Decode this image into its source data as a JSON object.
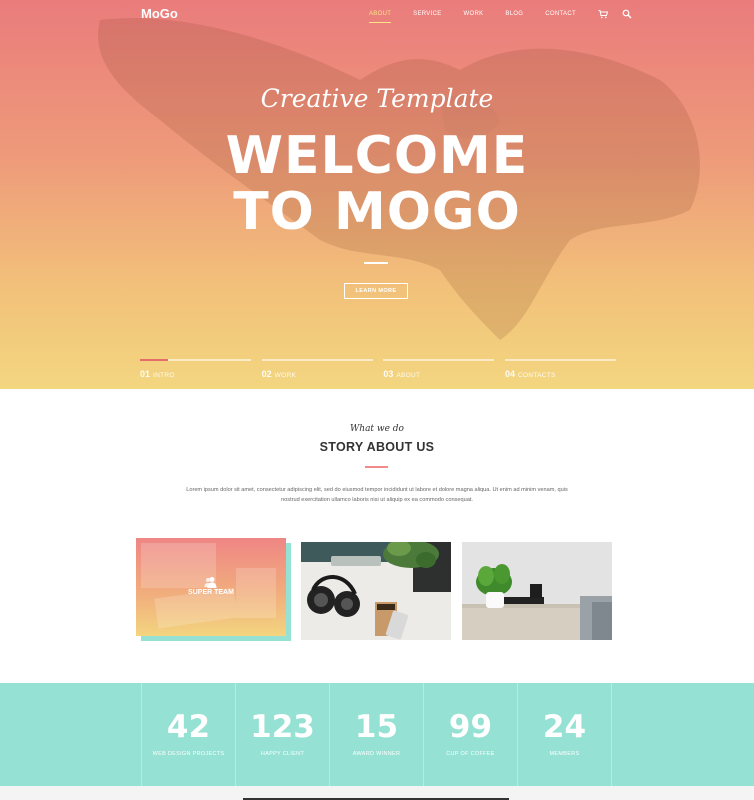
{
  "header": {
    "logo": "MoGo",
    "nav": [
      "ABOUT",
      "SERVICE",
      "WORK",
      "BLOG",
      "CONTACT"
    ],
    "active_nav": "ABOUT",
    "icons": [
      "cart-icon",
      "search-icon"
    ]
  },
  "hero": {
    "script_title": "Creative Template",
    "title_line1": "WELCOME",
    "title_line2": "TO MOGO",
    "button_label": "LEARN MORE",
    "slides": [
      {
        "num": "01",
        "label": "INTRO",
        "progress": 0.25
      },
      {
        "num": "02",
        "label": "WORK",
        "progress": 0
      },
      {
        "num": "03",
        "label": "ABOUT",
        "progress": 0
      },
      {
        "num": "04",
        "label": "CONTACTS",
        "progress": 0
      }
    ]
  },
  "story": {
    "eyebrow": "What we do",
    "title": "STORY ABOUT US",
    "text": "Lorem ipsum dolor sit amet, consectetur adipiscing elit, sed do eiusmod tempor incididunt ut labore et dolore magna aliqua. Ut enim ad minim venam, quis nostrud exercitation ullamco laboris nisi ut aliquip ex ea commodo consequat.",
    "cards": [
      {
        "label": "SUPER TEAM",
        "icon": "users-icon"
      },
      {
        "label": "",
        "icon": ""
      },
      {
        "label": "",
        "icon": ""
      }
    ]
  },
  "stats": [
    {
      "value": "42",
      "label": "WEB DESIGN PROJECTS"
    },
    {
      "value": "123",
      "label": "HAPPY CLIENT"
    },
    {
      "value": "15",
      "label": "AWARD WINNER"
    },
    {
      "value": "99",
      "label": "CUP OF COFFEE"
    },
    {
      "value": "24",
      "label": "MEMBERS"
    }
  ],
  "colors": {
    "accent": "#fce38a",
    "hero_top": "#ea7c7c",
    "hero_bottom": "#f3d680",
    "teal": "#95e1d3",
    "pink": "#f28a8a"
  }
}
